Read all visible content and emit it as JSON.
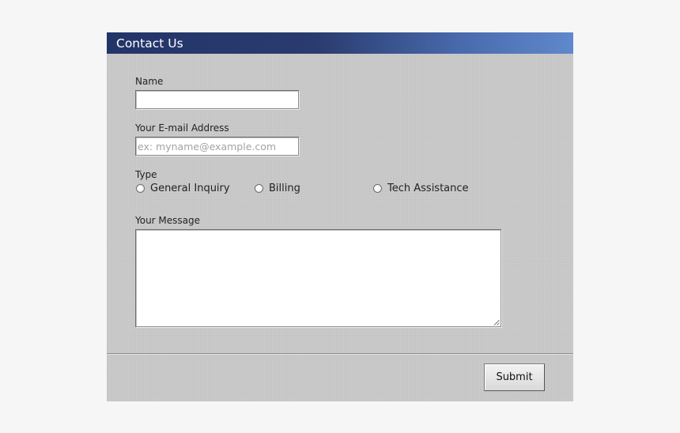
{
  "window": {
    "title": "Contact Us"
  },
  "form": {
    "name": {
      "label": "Name",
      "value": "",
      "placeholder": ""
    },
    "email": {
      "label": "Your E-mail Address",
      "value": "",
      "placeholder": "ex: myname@example.com"
    },
    "type": {
      "label": "Type",
      "options": [
        {
          "label": "General Inquiry",
          "selected": false
        },
        {
          "label": "Billing",
          "selected": false
        },
        {
          "label": "Tech Assistance",
          "selected": false
        }
      ]
    },
    "message": {
      "label": "Your Message",
      "value": ""
    },
    "submit_label": "Submit"
  },
  "icons": {
    "radio": "radio-circle",
    "resize": "resize-grip-icon"
  },
  "colors": {
    "title_bar_start": "#233568",
    "title_bar_end": "#6088cc",
    "panel_background": "#c9c9c9",
    "page_background": "#f6f6f6"
  }
}
